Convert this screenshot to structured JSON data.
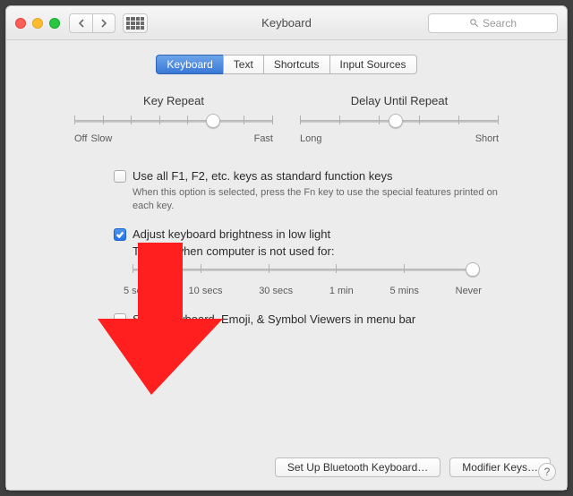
{
  "window": {
    "title": "Keyboard"
  },
  "search": {
    "placeholder": "Search"
  },
  "tabs": [
    "Keyboard",
    "Text",
    "Shortcuts",
    "Input Sources"
  ],
  "active_tab": 0,
  "key_repeat": {
    "title": "Key Repeat",
    "labels": [
      "Off",
      "Slow",
      "Fast"
    ],
    "knob_pct": 70
  },
  "delay_repeat": {
    "title": "Delay Until Repeat",
    "labels": [
      "Long",
      "Short"
    ],
    "knob_pct": 48
  },
  "use_fn": {
    "checked": false,
    "label": "Use all F1, F2, etc. keys as standard function keys",
    "hint": "When this option is selected, press the Fn key to use the special features printed on each key."
  },
  "auto_bright": {
    "checked": true,
    "label": "Adjust keyboard brightness in low light"
  },
  "dim": {
    "label": "Turn off when computer is not used for:",
    "ticks": [
      "5 secs",
      "10 secs",
      "30 secs",
      "1 min",
      "5 mins",
      "Never"
    ],
    "knob_pct": 100
  },
  "show_viewers": {
    "checked": false,
    "label": "Show Keyboard, Emoji, & Symbol Viewers in menu bar"
  },
  "buttons": {
    "bluetooth": "Set Up Bluetooth Keyboard…",
    "modifier": "Modifier Keys…"
  },
  "help": "?"
}
